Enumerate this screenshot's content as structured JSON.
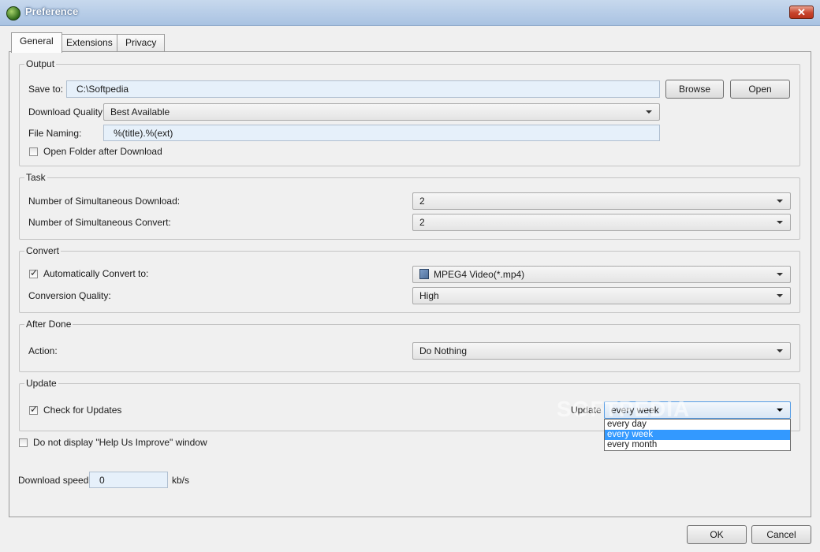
{
  "window": {
    "title": "Preference",
    "close_label": "✕"
  },
  "tabs": [
    {
      "label": "General"
    },
    {
      "label": "Extensions"
    },
    {
      "label": "Privacy"
    }
  ],
  "output": {
    "title": "Output",
    "save_to_label": "Save to:",
    "save_to_value": "C:\\Softpedia",
    "browse_label": "Browse",
    "open_label": "Open",
    "quality_label": "Download Quality:",
    "quality_value": "Best Available",
    "naming_label": "File Naming:",
    "naming_value": "%(title).%(ext)",
    "open_folder_label": "Open Folder after Download",
    "open_folder_checked": false
  },
  "task": {
    "title": "Task",
    "sim_download_label": "Number of Simultaneous Download:",
    "sim_download_value": "2",
    "sim_convert_label": "Number of Simultaneous Convert:",
    "sim_convert_value": "2"
  },
  "convert": {
    "title": "Convert",
    "auto_label": "Automatically Convert to:",
    "auto_checked": true,
    "format_value": "MPEG4 Video(*.mp4)",
    "format_icon": "video-file-icon",
    "quality_label": "Conversion Quality:",
    "quality_value": "High"
  },
  "after_done": {
    "title": "After Done",
    "action_label": "Action:",
    "action_value": "Do Nothing"
  },
  "update": {
    "title": "Update",
    "check_label": "Check for Updates",
    "check_checked": true,
    "frequency_label": "Update",
    "frequency_value": "every week",
    "options": [
      "every day",
      "every week",
      "every month"
    ],
    "selected_option": "every week"
  },
  "help_improve": {
    "label": "Do not display \"Help Us Improve\" window",
    "checked": false
  },
  "speed": {
    "label": "Download speed:",
    "value": "0",
    "unit": "kb/s"
  },
  "footer": {
    "ok_label": "OK",
    "cancel_label": "Cancel"
  },
  "watermark": "SOFTPEDIA",
  "colors": {
    "titlebar": "#a9c3e2",
    "field_bg": "#e6f0fa",
    "selection": "#3399ff",
    "close_button": "#c8442c"
  }
}
